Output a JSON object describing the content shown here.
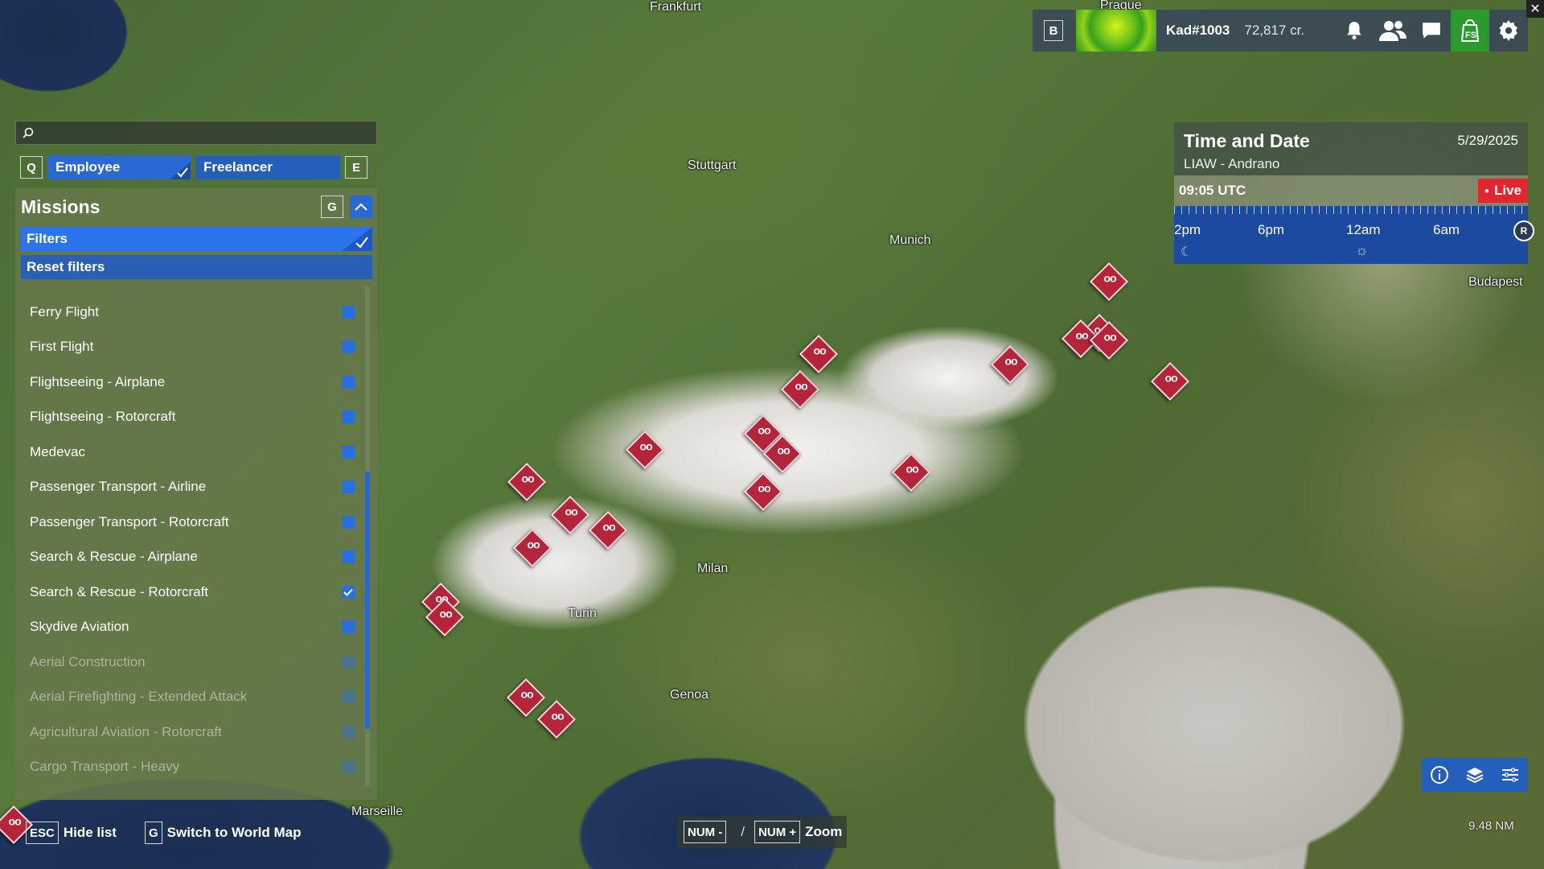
{
  "map": {
    "cities": [
      "Frankfurt",
      "Prague",
      "Stuttgart",
      "Munich",
      "Budapest",
      "Milan",
      "Turin",
      "Genoa",
      "Marseille"
    ]
  },
  "topbar": {
    "key": "B",
    "pilot_name": "Kad#1003",
    "credits": "72,817 cr.",
    "icons": [
      "bell-icon",
      "friends-icon",
      "chat-icon",
      "shop-icon",
      "settings-icon"
    ]
  },
  "search": {
    "value": "",
    "placeholder": ""
  },
  "mode": {
    "left_key": "Q",
    "right_key": "E",
    "tabs": [
      {
        "label": "Employee",
        "active": true
      },
      {
        "label": "Freelancer",
        "active": false
      }
    ]
  },
  "missions": {
    "title": "Missions",
    "key": "G",
    "filters_label": "Filters",
    "reset_label": "Reset filters",
    "items": [
      {
        "label": "Ferry Flight",
        "enabled": true,
        "checked": false
      },
      {
        "label": "First Flight",
        "enabled": true,
        "checked": false
      },
      {
        "label": "Flightseeing - Airplane",
        "enabled": true,
        "checked": false
      },
      {
        "label": "Flightseeing - Rotorcraft",
        "enabled": true,
        "checked": false
      },
      {
        "label": "Medevac",
        "enabled": true,
        "checked": false
      },
      {
        "label": "Passenger Transport - Airline",
        "enabled": true,
        "checked": false
      },
      {
        "label": "Passenger Transport - Rotorcraft",
        "enabled": true,
        "checked": false
      },
      {
        "label": "Search & Rescue - Airplane",
        "enabled": true,
        "checked": false
      },
      {
        "label": "Search & Rescue - Rotorcraft",
        "enabled": true,
        "checked": true
      },
      {
        "label": "Skydive Aviation",
        "enabled": true,
        "checked": false
      },
      {
        "label": "Aerial Construction",
        "enabled": false,
        "checked": false
      },
      {
        "label": "Aerial Firefighting - Extended Attack",
        "enabled": false,
        "checked": false
      },
      {
        "label": "Agricultural Aviation - Rotorcraft",
        "enabled": false,
        "checked": false
      },
      {
        "label": "Cargo Transport - Heavy",
        "enabled": false,
        "checked": false
      }
    ]
  },
  "time_date": {
    "title": "Time and Date",
    "date": "5/29/2025",
    "location": "LIAW - Andrano",
    "time": "09:05 UTC",
    "live_label": "Live",
    "ticks": [
      "2pm",
      "6pm",
      "12am",
      "6am"
    ]
  },
  "scale": "9.48 NM",
  "hints": {
    "hide": {
      "key": "ESC",
      "label": "Hide list"
    },
    "world": {
      "key": "G",
      "label": "Switch to World Map"
    },
    "zoom_out_key": "NUM -",
    "separator": "/",
    "zoom_in_key": "NUM +",
    "zoom_label": "Zoom"
  },
  "colors": {
    "accent": "#2a69d3",
    "pin": "#b5253a",
    "live": "#e2262f",
    "shop": "#2c9a2e"
  }
}
